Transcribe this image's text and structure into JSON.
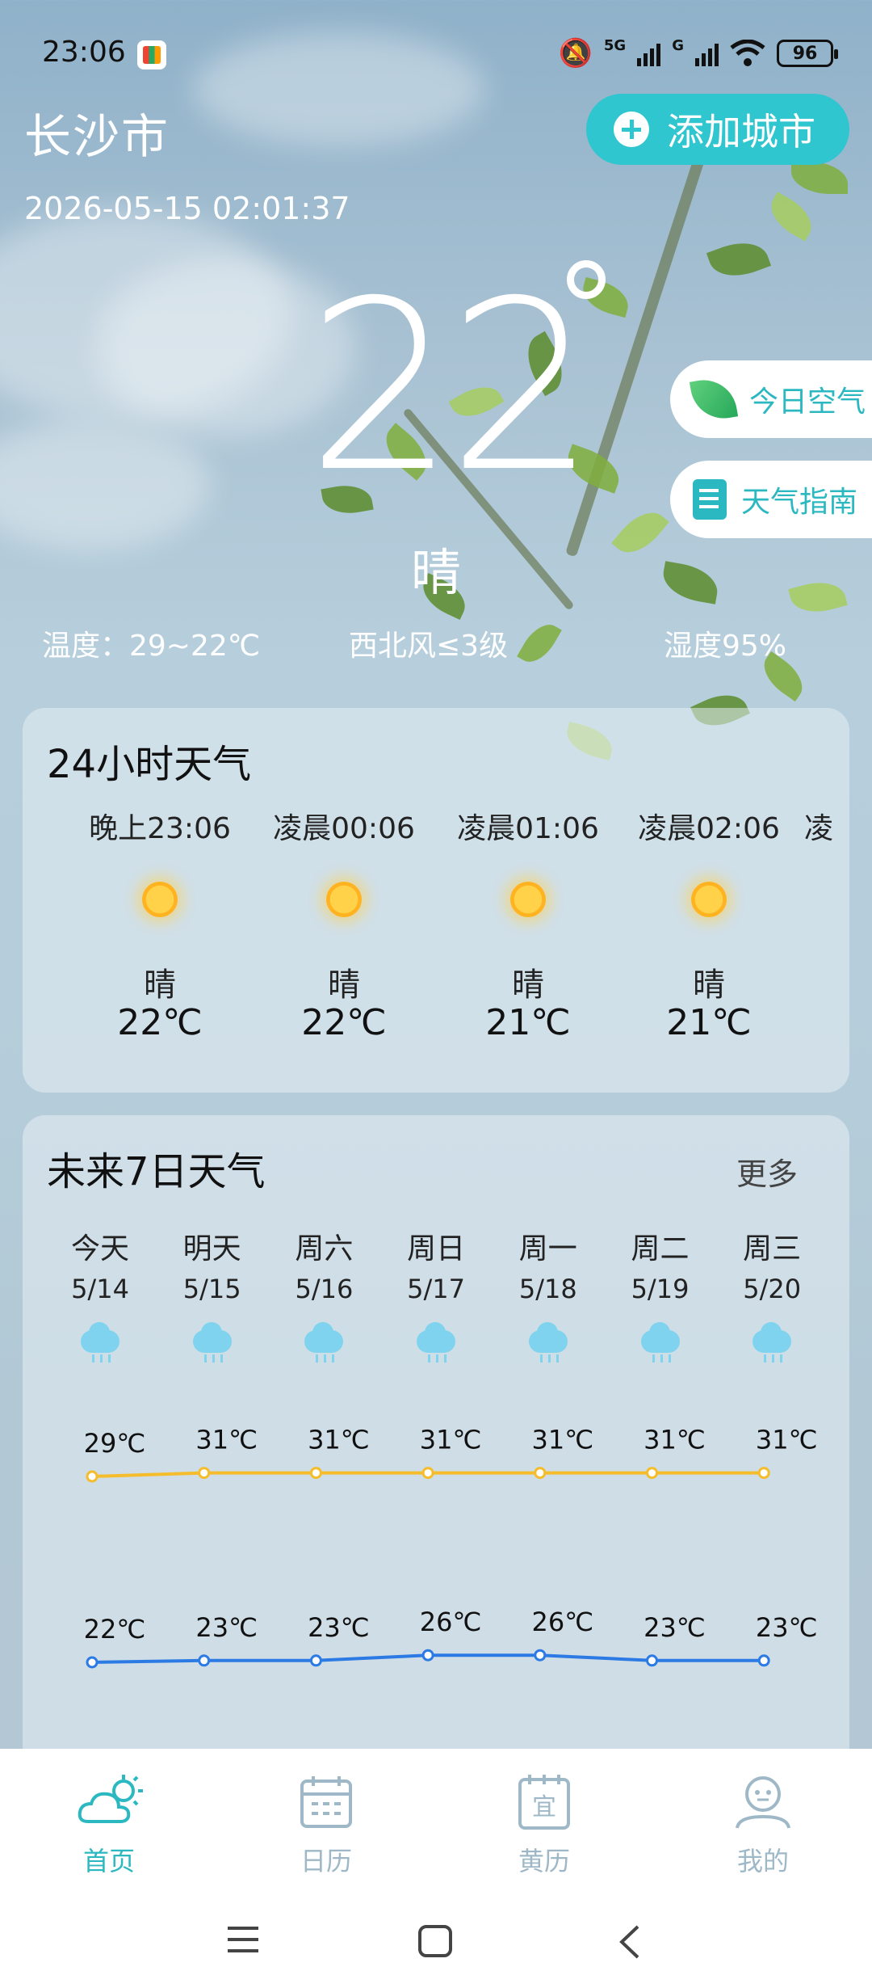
{
  "status_bar": {
    "time": "23:06",
    "network_labels": [
      "5G",
      "G"
    ],
    "battery": "96"
  },
  "header": {
    "city": "长沙市",
    "datetime": "2026-05-15 02:01:37",
    "add_city_label": "添加城市"
  },
  "current": {
    "temperature": "22",
    "condition": "晴",
    "temp_range": "温度：29~22℃",
    "wind": "西北风≤3级",
    "humidity": "湿度95%"
  },
  "side_buttons": {
    "air_label": "今日空气",
    "guide_label": "天气指南"
  },
  "hourly": {
    "title": "24小时天气",
    "items": [
      {
        "time": "晚上23:06",
        "condition": "晴",
        "temp": "22℃"
      },
      {
        "time": "凌晨00:06",
        "condition": "晴",
        "temp": "22℃"
      },
      {
        "time": "凌晨01:06",
        "condition": "晴",
        "temp": "21℃"
      },
      {
        "time": "凌晨02:06",
        "condition": "晴",
        "temp": "21℃"
      },
      {
        "time": "凌",
        "condition": "",
        "temp": ""
      }
    ]
  },
  "daily": {
    "title": "未来7日天气",
    "more_label": "更多",
    "days": [
      {
        "name": "今天",
        "date": "5/14",
        "high": "29℃",
        "low": "22℃"
      },
      {
        "name": "明天",
        "date": "5/15",
        "high": "31℃",
        "low": "23℃"
      },
      {
        "name": "周六",
        "date": "5/16",
        "high": "31℃",
        "low": "23℃"
      },
      {
        "name": "周日",
        "date": "5/17",
        "high": "31℃",
        "low": "26℃"
      },
      {
        "name": "周一",
        "date": "5/18",
        "high": "31℃",
        "low": "26℃"
      },
      {
        "name": "周二",
        "date": "5/19",
        "high": "31℃",
        "low": "23℃"
      },
      {
        "name": "周三",
        "date": "5/20",
        "high": "31℃",
        "low": "23℃"
      }
    ]
  },
  "chart_data": {
    "type": "line",
    "categories": [
      "今天",
      "明天",
      "周六",
      "周日",
      "周一",
      "周二",
      "周三"
    ],
    "series": [
      {
        "values": [
          29,
          31,
          31,
          31,
          31,
          31,
          31
        ],
        "color": "#f5bd2b"
      },
      {
        "values": [
          22,
          23,
          23,
          26,
          26,
          23,
          23
        ],
        "color": "#2c7be5"
      }
    ]
  },
  "tabbar": {
    "items": [
      {
        "label": "首页",
        "icon": "cloud-sun-icon",
        "active": true
      },
      {
        "label": "日历",
        "icon": "calendar-icon",
        "active": false
      },
      {
        "label": "黄历",
        "icon": "almanac-icon",
        "active": false,
        "glyph": "宜"
      },
      {
        "label": "我的",
        "icon": "profile-icon",
        "active": false
      }
    ]
  },
  "colors": {
    "accent": "#2fc6cf",
    "high_line": "#f5bd2b",
    "low_line": "#2c7be5",
    "tab_inactive": "#9eb8c7"
  }
}
